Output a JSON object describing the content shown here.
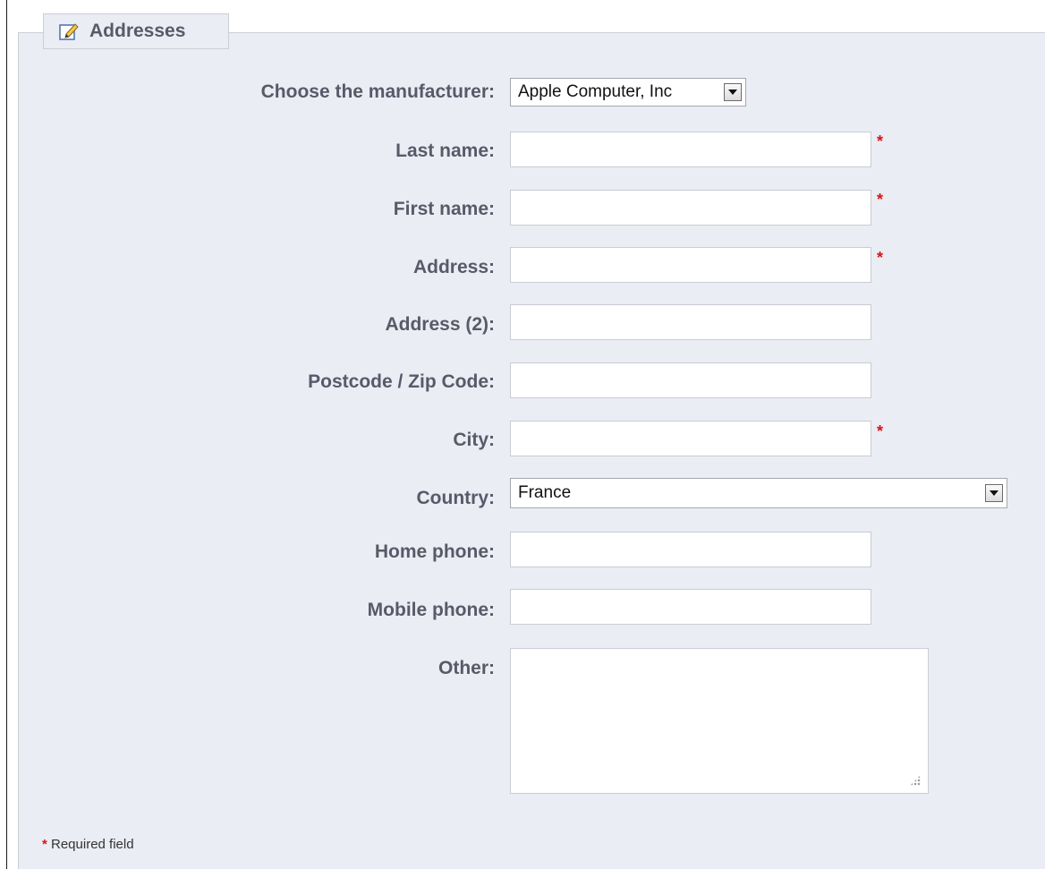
{
  "legend": {
    "title": "Addresses",
    "icon": "edit-icon"
  },
  "form": {
    "manufacturer": {
      "label": "Choose the manufacturer:",
      "value": "Apple Computer, Inc"
    },
    "last_name": {
      "label": "Last name:",
      "value": "",
      "required": "*"
    },
    "first_name": {
      "label": "First name:",
      "value": "",
      "required": "*"
    },
    "address": {
      "label": "Address:",
      "value": "",
      "required": "*"
    },
    "address2": {
      "label": "Address (2):",
      "value": ""
    },
    "postcode": {
      "label": "Postcode / Zip Code:",
      "value": ""
    },
    "city": {
      "label": "City:",
      "value": "",
      "required": "*"
    },
    "country": {
      "label": "Country:",
      "value": "France"
    },
    "home_phone": {
      "label": "Home phone:",
      "value": ""
    },
    "mobile_phone": {
      "label": "Mobile phone:",
      "value": ""
    },
    "other": {
      "label": "Other:",
      "value": ""
    }
  },
  "footnote": {
    "star": "*",
    "text": " Required field"
  },
  "colors": {
    "panel_bg": "#ebedf4",
    "label": "#585a69",
    "required": "#d51616"
  }
}
